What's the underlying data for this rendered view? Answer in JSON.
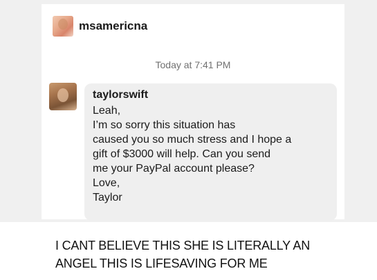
{
  "header": {
    "username": "msamericna"
  },
  "conversation": {
    "timestamp": "Today at 7:41 PM",
    "message": {
      "sender": "taylorswift",
      "lines": [
        "Leah,",
        "I’m so sorry this situation has",
        "caused you so much stress and I hope a",
        "gift of $3000 will help. Can you send",
        "me your PayPal account please?",
        "Love,",
        "Taylor"
      ]
    }
  },
  "caption": {
    "lines": [
      "I CANT BELIEVE THIS SHE IS LITERALLY AN",
      "ANGEL THIS IS LIFESAVING FOR ME"
    ]
  }
}
